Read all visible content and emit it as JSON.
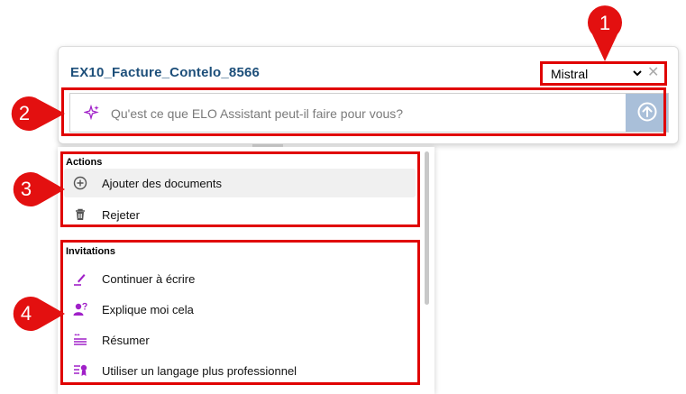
{
  "header": {
    "doc_title": "EX10_Facture_Contelo_8566",
    "model_selected": "Mistral",
    "clear_glyph": "✕"
  },
  "prompt": {
    "placeholder": "Qu'est ce que ELO Assistant peut-il faire pour vous?"
  },
  "actions": {
    "heading": "Actions",
    "items": [
      {
        "label": "Ajouter des documents",
        "icon": "plus-circle-icon"
      },
      {
        "label": "Rejeter",
        "icon": "trash-icon"
      }
    ]
  },
  "invitations": {
    "heading": "Invitations",
    "items": [
      {
        "label": "Continuer à écrire",
        "icon": "pen-icon"
      },
      {
        "label": "Explique moi cela",
        "icon": "person-question-icon"
      },
      {
        "label": "Résumer",
        "icon": "summarize-icon"
      },
      {
        "label": "Utiliser un langage plus professionnel",
        "icon": "professional-icon"
      }
    ]
  },
  "callouts": [
    "1",
    "2",
    "3",
    "4"
  ],
  "colors": {
    "accent_purple": "#a020c8",
    "title_blue": "#1d4f7a",
    "send_button": "#a9bfd9",
    "callout_red": "#e31010"
  }
}
